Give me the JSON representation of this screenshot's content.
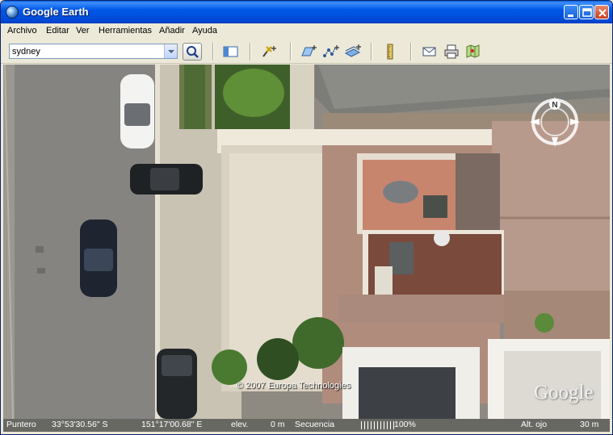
{
  "window": {
    "title": "Google Earth"
  },
  "icons": {
    "app": "globe-icon",
    "minimize": "minimize-icon",
    "maximize": "maximize-icon",
    "close": "close-icon"
  },
  "menu": {
    "items": [
      "Archivo",
      "Editar",
      "Ver",
      "Herramientas",
      "Añadir",
      "Ayuda"
    ]
  },
  "search": {
    "value": "sydney",
    "placeholder": ""
  },
  "toolbar": {
    "tools": [
      "sidebar-toggle-icon",
      "placemark-icon",
      "polygon-icon",
      "path-icon",
      "image-overlay-icon",
      "ruler-icon",
      "email-icon",
      "print-icon",
      "google-maps-icon"
    ]
  },
  "map": {
    "copyright": "© 2007 Europa Technologies",
    "watermark": "Google",
    "compass_label": "N"
  },
  "status": {
    "pointer_label": "Puntero",
    "latitude": "33°53'30.56\" S",
    "longitude": "151°17'00.68\" E",
    "elev_label": "elev.",
    "elev_value": "0 m",
    "streaming_label": "Secuencia",
    "streaming_percent": "100%",
    "eye_alt_label": "Alt. ojo",
    "eye_alt_value": "30 m"
  }
}
